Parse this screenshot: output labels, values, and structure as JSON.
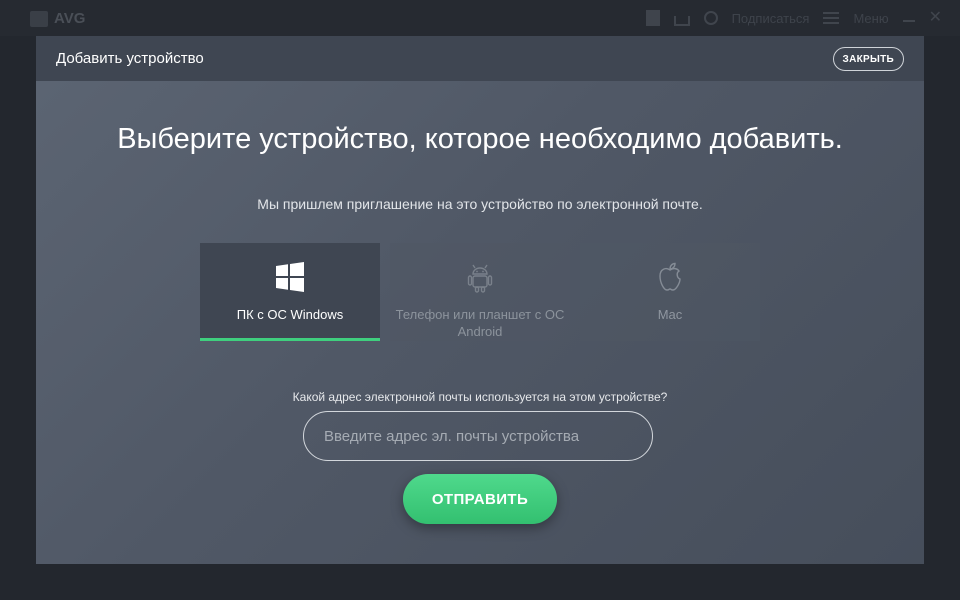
{
  "app": {
    "logo_text": "AVG",
    "account_text": "Подписаться",
    "menu_text": "Меню"
  },
  "modal": {
    "title": "Добавить устройство",
    "close_label": "ЗАКРЫТЬ",
    "heading": "Выберите устройство, которое необходимо добавить.",
    "subheading": "Мы пришлем приглашение на это устройство по электронной почте.",
    "devices": [
      {
        "label": "ПК с ОС Windows",
        "icon": "windows-icon",
        "selected": true
      },
      {
        "label": "Телефон или планшет с ОС Android",
        "icon": "android-icon",
        "selected": false
      },
      {
        "label": "Mac",
        "icon": "apple-icon",
        "selected": false
      }
    ],
    "email_question": "Какой адрес электронной почты используется на этом устройстве?",
    "email_placeholder": "Введите адрес эл. почты устройства",
    "email_value": "",
    "send_label": "ОТПРАВИТЬ"
  },
  "colors": {
    "accent": "#3fcf7e",
    "header": "#3f4652",
    "backdrop": "#23272e"
  }
}
